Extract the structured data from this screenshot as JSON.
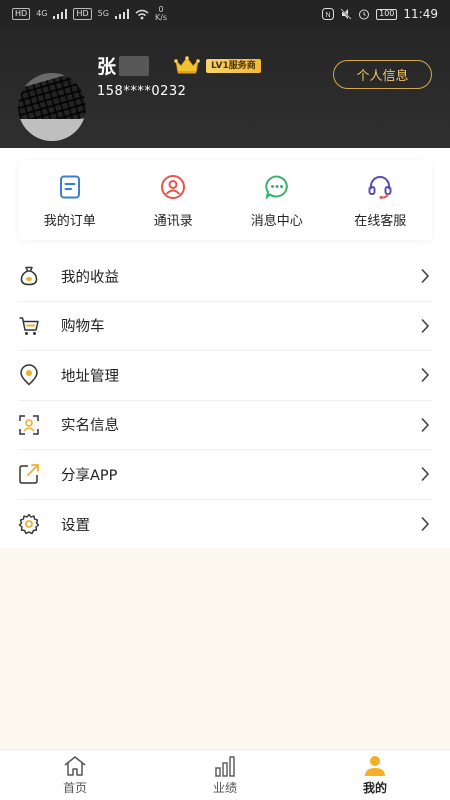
{
  "status_bar": {
    "network_chip_1": "HD",
    "network_chip_2": "HD",
    "signal_1": "4G",
    "signal_2": "5G",
    "speed_value": "0",
    "speed_unit": "K/s",
    "battery": "100",
    "time": "11:49"
  },
  "profile": {
    "name_visible": "张",
    "level_badge": "LV1服务商",
    "phone": "158****0232",
    "info_button": "个人信息"
  },
  "quick_actions": [
    {
      "label": "我的订单",
      "icon": "order-icon",
      "color": "#3a7fd5"
    },
    {
      "label": "通讯录",
      "icon": "contacts-icon",
      "color": "#e8534a"
    },
    {
      "label": "消息中心",
      "icon": "message-icon",
      "color": "#34b36b"
    },
    {
      "label": "在线客服",
      "icon": "headset-icon",
      "color": "#5b4fb3"
    }
  ],
  "menu": [
    {
      "label": "我的收益",
      "icon": "money-bag-icon"
    },
    {
      "label": "购物车",
      "icon": "cart-icon"
    },
    {
      "label": "地址管理",
      "icon": "location-icon"
    },
    {
      "label": "实名信息",
      "icon": "id-scan-icon"
    },
    {
      "label": "分享APP",
      "icon": "share-icon"
    },
    {
      "label": "设置",
      "icon": "gear-icon"
    }
  ],
  "tabs": [
    {
      "label": "首页",
      "icon": "home-icon",
      "active": false
    },
    {
      "label": "业绩",
      "icon": "bar-chart-icon",
      "active": false
    },
    {
      "label": "我的",
      "icon": "profile-icon",
      "active": true
    }
  ],
  "colors": {
    "accent": "#f2b027",
    "header_bg": "#2b2b2b",
    "page_bg": "#fdf8ef"
  }
}
